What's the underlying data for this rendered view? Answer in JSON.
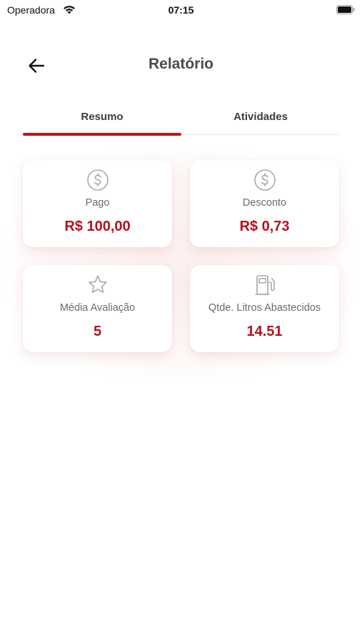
{
  "status_bar": {
    "carrier": "Operadora",
    "time": "07:15"
  },
  "header": {
    "title": "Relatório"
  },
  "tabs": [
    {
      "label": "Resumo",
      "active": true
    },
    {
      "label": "Atividades",
      "active": false
    }
  ],
  "cards": {
    "pago": {
      "label": "Pago",
      "value": "R$ 100,00",
      "icon": "dollar-circle-icon"
    },
    "desconto": {
      "label": "Desconto",
      "value": "R$ 0,73",
      "icon": "dollar-circle-icon"
    },
    "media_avaliacao": {
      "label": "Média Avaliação",
      "value": "5",
      "icon": "star-icon"
    },
    "litros": {
      "label": "Qtde. Litros Abastecidos",
      "value": "14.51",
      "icon": "fuel-pump-icon"
    }
  },
  "colors": {
    "accent": "#c0161c",
    "value_text": "#b5121b",
    "icon": "#a8a8a8"
  }
}
